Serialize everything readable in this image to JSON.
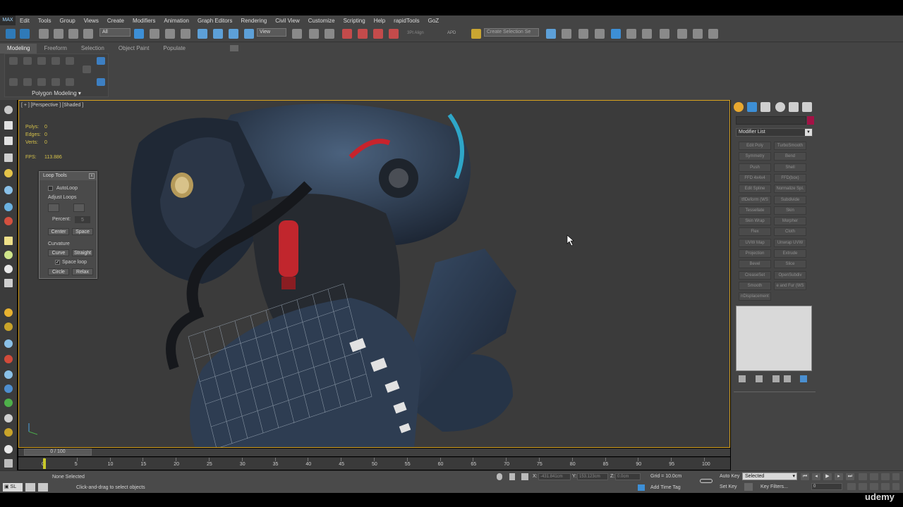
{
  "menu": {
    "logo": "MAX",
    "items": [
      "Edit",
      "Tools",
      "Group",
      "Views",
      "Create",
      "Modifiers",
      "Animation",
      "Graph Editors",
      "Rendering",
      "Civil View",
      "Customize",
      "Scripting",
      "Help",
      "rapidTools",
      "GoZ"
    ]
  },
  "toolbar": {
    "filter_select": "All",
    "view_select": "View",
    "align_label": "3Pt Align",
    "apd_label": "APD",
    "selection_set": "Create Selection Se"
  },
  "ribbon": {
    "tabs": [
      "Modeling",
      "Freeform",
      "Selection",
      "Object Paint",
      "Populate"
    ],
    "active_tab": "Modeling",
    "panel_label": "Polygon Modeling"
  },
  "viewport": {
    "label": "[ + ] [Perspective ] [Shaded ]",
    "stats": [
      {
        "label": "Polys:",
        "value": "0"
      },
      {
        "label": "Edges:",
        "value": "0"
      },
      {
        "label": "Verts:",
        "value": "0"
      }
    ],
    "fps_label": "FPS:",
    "fps_value": "113.886"
  },
  "loop_tools": {
    "title": "Loop Tools",
    "close": "x",
    "autoloop": "AutoLoop",
    "adjust_loops": "Adjust Loops",
    "percent_label": "Percent:",
    "percent_value": "5",
    "center": "Center",
    "space": "Space",
    "curvature": "Curvature",
    "curve": "Curve",
    "straight": "Straight",
    "space_loop": "Space loop",
    "circle": "Circle",
    "relax": "Relax"
  },
  "command_panel": {
    "modifier_list": "Modifier List",
    "modifiers": [
      [
        "Edit Poly",
        "TurboSmooth"
      ],
      [
        "Symmetry",
        "Bend"
      ],
      [
        "Push",
        "Shell"
      ],
      [
        "FFD 4x4x4",
        "FFD(box)"
      ],
      [
        "Edit Spline",
        "Normalize Spl."
      ],
      [
        "tflDeform (WS",
        "Subdivide"
      ],
      [
        "Tessellate",
        "Skin"
      ],
      [
        "Skin Wrap",
        "Morpher"
      ],
      [
        "Flex",
        "Cloth"
      ],
      [
        "UVW Map",
        "Unwrap UVW"
      ],
      [
        "Projection",
        "Extrude"
      ],
      [
        "Bevel",
        "Slice"
      ],
      [
        "CreaseSet",
        "OpenSubdiv"
      ],
      [
        "Smooth",
        "e and Fur (WS"
      ],
      [
        "nDisplacement",
        ""
      ]
    ]
  },
  "timeline": {
    "slider": "0 / 100",
    "ticks": [
      "0",
      "5",
      "10",
      "15",
      "20",
      "25",
      "30",
      "35",
      "40",
      "45",
      "50",
      "55",
      "60",
      "65",
      "70",
      "75",
      "80",
      "85",
      "90",
      "95",
      "100"
    ]
  },
  "status": {
    "selection": "None Selected",
    "prompt": "Click-and-drag to select objects",
    "x_label": "X:",
    "x_value": "-431.841cm",
    "y_label": "Y:",
    "y_value": "153.123cm",
    "z_label": "Z:",
    "z_value": "0.0cm",
    "grid": "Grid = 10.0cm",
    "add_time_tag": "Add Time Tag",
    "auto_key": "Auto Key",
    "set_key": "Set Key",
    "selected_select": "Selected",
    "key_filters": "Key Filters...",
    "frame": "0"
  },
  "watermark": "udemy",
  "colors": {
    "accent": "#d8a21e",
    "stats": "#d6c24a",
    "material_swatch": "#a31245"
  }
}
